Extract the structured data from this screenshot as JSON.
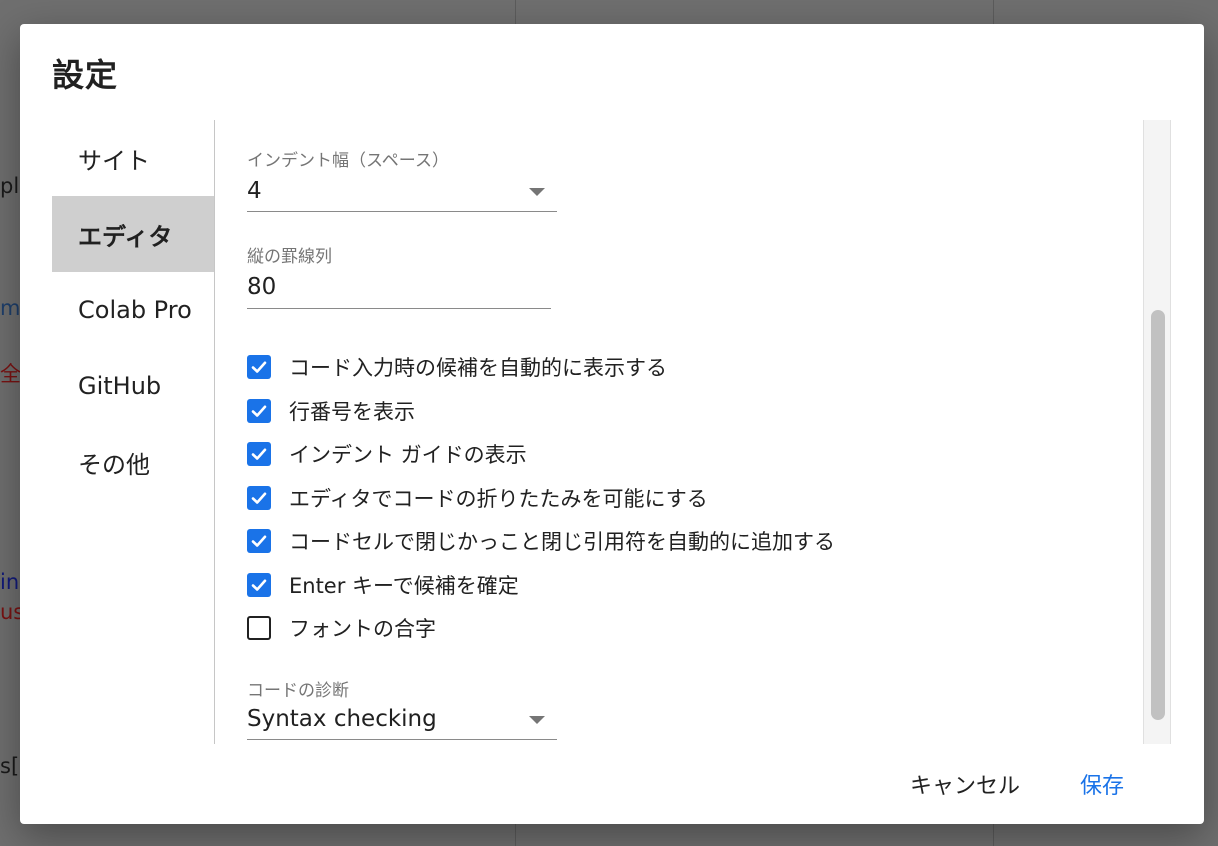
{
  "background": {
    "fragments": [
      "pl",
      "m",
      "全て",
      "in",
      "us",
      "s["
    ]
  },
  "dialog": {
    "title": "設定"
  },
  "nav": {
    "items": [
      {
        "label": "サイト",
        "active": false
      },
      {
        "label": "エディタ",
        "active": true
      },
      {
        "label": "Colab Pro",
        "active": false
      },
      {
        "label": "GitHub",
        "active": false
      },
      {
        "label": "その他",
        "active": false
      }
    ]
  },
  "editor": {
    "indent": {
      "label": "インデント幅（スペース）",
      "value": "4"
    },
    "ruler": {
      "label": "縦の罫線列",
      "value": "80"
    },
    "checkboxes": [
      {
        "label": "コード入力時の候補を自動的に表示する",
        "checked": true
      },
      {
        "label": "行番号を表示",
        "checked": true
      },
      {
        "label": "インデント ガイドの表示",
        "checked": true
      },
      {
        "label": "エディタでコードの折りたたみを可能にする",
        "checked": true
      },
      {
        "label": "コードセルで閉じかっこと閉じ引用符を自動的に追加する",
        "checked": true
      },
      {
        "label": "Enter キーで候補を確定",
        "checked": true
      },
      {
        "label": "フォントの合字",
        "checked": false
      }
    ],
    "diagnostics": {
      "label": "コードの診断",
      "value": "Syntax checking"
    }
  },
  "footer": {
    "cancel_label": "キャンセル",
    "save_label": "保存"
  },
  "colors": {
    "accent": "#1a73e8",
    "overlay": "#6f6f6f",
    "nav_active": "#cfcfcf"
  }
}
